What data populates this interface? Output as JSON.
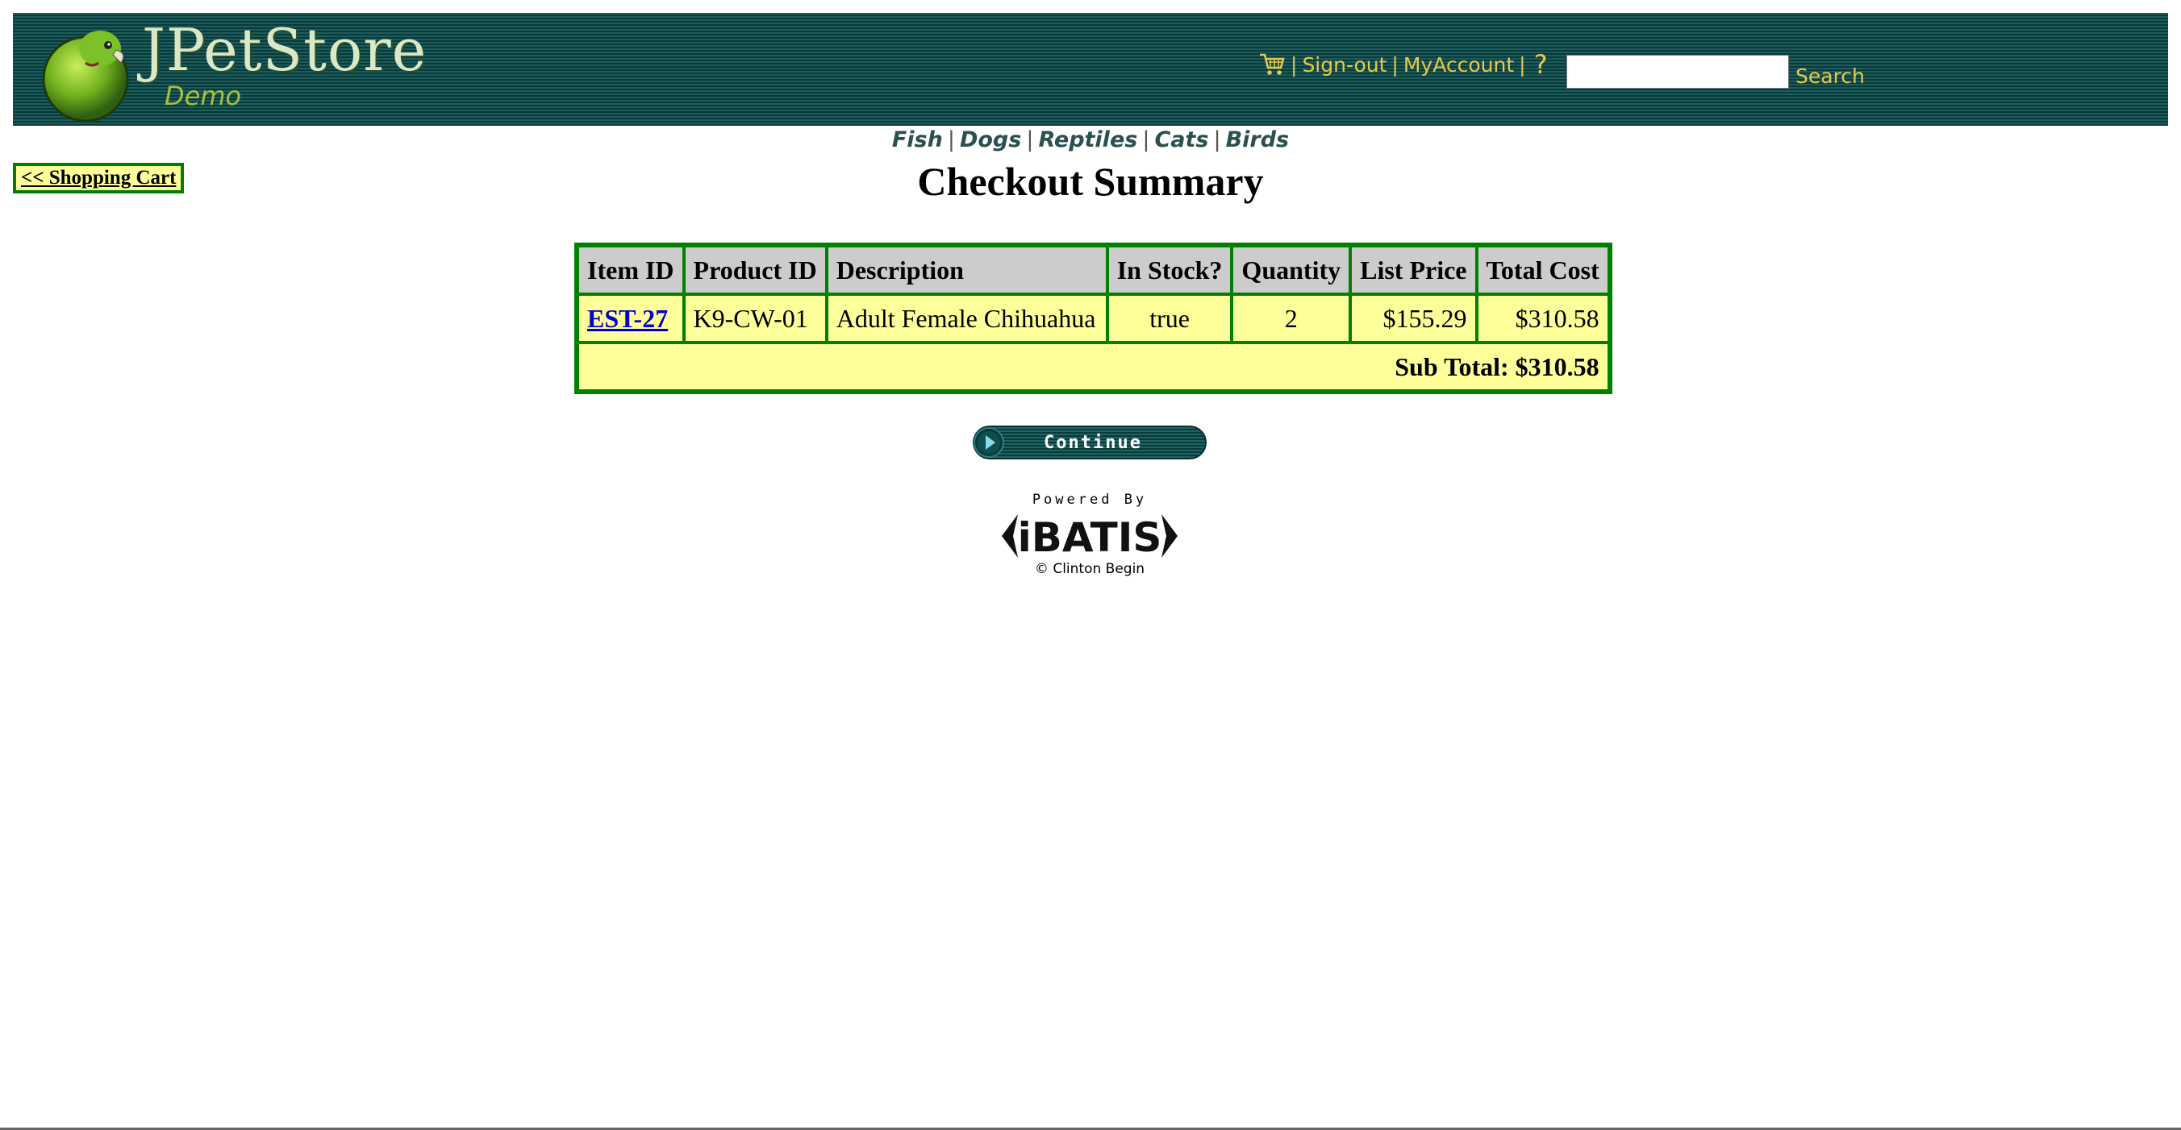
{
  "header": {
    "logo_title": "JPetStore",
    "logo_subtitle": "Demo",
    "menu": {
      "sign_out": "Sign-out",
      "my_account": "MyAccount",
      "help": "?"
    },
    "search": {
      "placeholder": "",
      "value": "",
      "button_label": "Search"
    }
  },
  "categories": [
    "Fish",
    "Dogs",
    "Reptiles",
    "Cats",
    "Birds"
  ],
  "back_link": "<< Shopping Cart",
  "page_title": "Checkout Summary",
  "table": {
    "headers": [
      "Item ID",
      "Product ID",
      "Description",
      "In Stock?",
      "Quantity",
      "List Price",
      "Total Cost"
    ],
    "rows": [
      {
        "item_id": "EST-27",
        "product_id": "K9-CW-01",
        "description": "Adult Female Chihuahua",
        "in_stock": "true",
        "quantity": "2",
        "list_price": "$155.29",
        "total_cost": "$310.58"
      }
    ],
    "subtotal": "Sub Total: $310.58"
  },
  "continue_button": "Continue",
  "powered_by": {
    "label": "Powered By",
    "brand": "iBATIS",
    "credit": "© Clinton Begin"
  },
  "colors": {
    "header_bg": "#0f4545",
    "header_link": "#e6c94a",
    "table_border": "#008000",
    "table_header_bg": "#cccccc",
    "table_cell_bg": "#ffff99",
    "link_blue": "#0000cc"
  },
  "icons": [
    "parrot-logo",
    "cart-icon",
    "help-icon",
    "play-icon"
  ]
}
